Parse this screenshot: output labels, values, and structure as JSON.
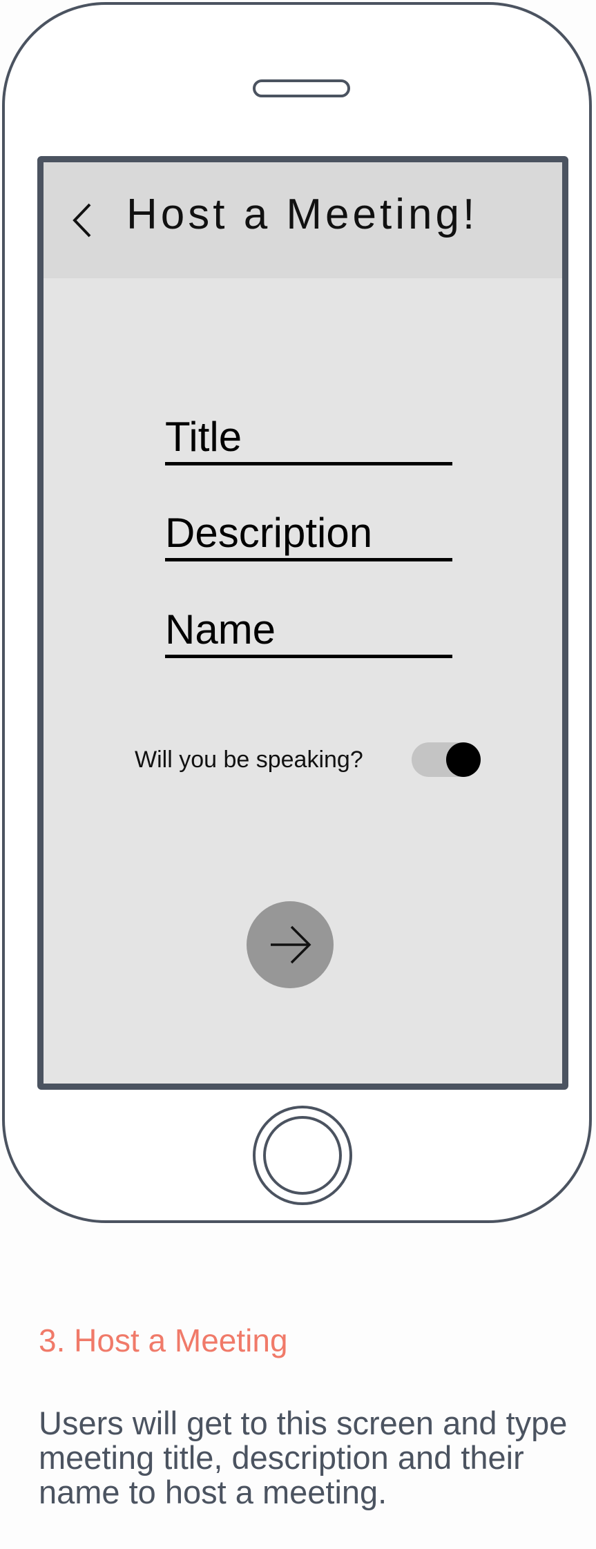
{
  "app": {
    "title": "Host a Meeting!"
  },
  "form": {
    "title_placeholder": "Title",
    "description_placeholder": "Description",
    "name_placeholder": "Name"
  },
  "speaking": {
    "label": "Will you be speaking?",
    "enabled": true
  },
  "icons": {
    "back": "chevron-left-icon",
    "next": "arrow-right-icon"
  },
  "caption": {
    "heading": "3. Host a Meeting",
    "body": "Users will get to this screen and type meeting title, description and their name to host a meeting."
  },
  "colors": {
    "frame": "#4b5360",
    "screen_bg": "#e4e4e4",
    "appbar_bg": "#d9d9d9",
    "next_button": "#979797",
    "toggle_track": "#c4c4c4",
    "toggle_knob": "#000000",
    "caption_heading": "#f07a69",
    "caption_body": "#4b5360"
  }
}
